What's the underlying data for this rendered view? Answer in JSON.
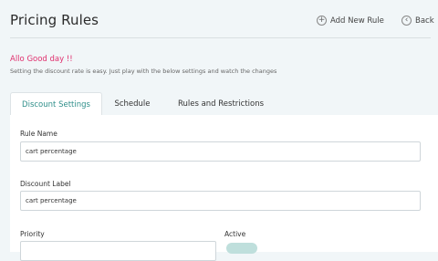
{
  "header": {
    "title": "Pricing Rules",
    "add_new_rule": "Add New Rule",
    "back": "Back"
  },
  "intro": {
    "greeting": "Allo Good day !!",
    "description": "Setting the discount rate is easy. Just play with the below settings and watch the changes"
  },
  "tabs": [
    {
      "label": "Discount Settings",
      "active": true
    },
    {
      "label": "Schedule",
      "active": false
    },
    {
      "label": "Rules and Restrictions",
      "active": false
    }
  ],
  "form": {
    "rule_name_label": "Rule Name",
    "rule_name_value": "cart percentage",
    "discount_label_label": "Discount Label",
    "discount_label_value": "cart percentage",
    "priority_label": "Priority",
    "active_label": "Active"
  },
  "colors": {
    "accent": "#2f8f8a",
    "greeting": "#e0306e",
    "page_background": "#f1f6f8"
  }
}
